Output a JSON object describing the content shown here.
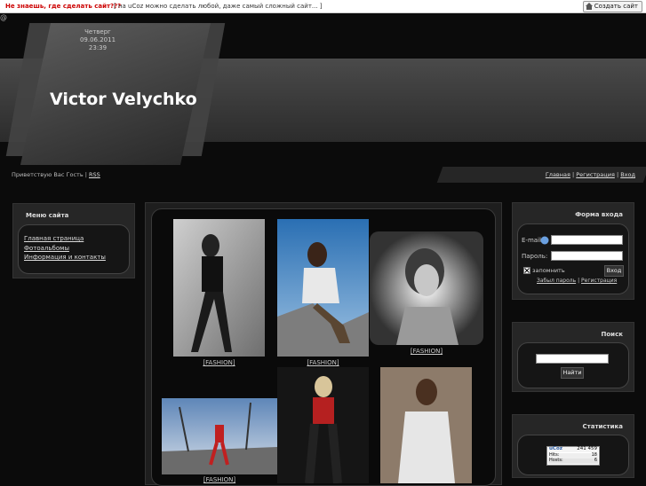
{
  "topbar": {
    "headline": "Не знаешь, где сделать сайт???",
    "message": "[ на uCoz можно сделать любой, даже самый сложный сайт... ]",
    "create_button": "Создать сайт"
  },
  "header": {
    "at_sign": "@",
    "day": "Четверг",
    "date": "09.06.2011",
    "time": "23:39",
    "site_title": "Victor Velychko"
  },
  "nav": {
    "greeting": "Приветствую Вас Гость |",
    "rss": "RSS",
    "links": [
      "Главная",
      "Регистрация",
      "Вход"
    ],
    "sep": "|"
  },
  "menu": {
    "title": "Меню сайта",
    "items": [
      "Главная страница",
      "Фотоальбомы",
      "Информация и контакты"
    ]
  },
  "gallery": {
    "captions": [
      "[FASHION]",
      "[FASHION]",
      "[FASHION]",
      "[FASHION]"
    ]
  },
  "login": {
    "title": "Форма входа",
    "email_label": "E-mail:",
    "password_label": "Пароль:",
    "remember_label": "запомнить",
    "submit": "Вход",
    "forgot": "Забыл пароль",
    "sep": "|",
    "register": "Регистрация"
  },
  "search": {
    "title": "Поиск",
    "button": "Найти"
  },
  "stats": {
    "title": "Статистика",
    "counter_brand": "uCoz",
    "counter_total": "241 459",
    "hits_label": "Hits:",
    "hits_value": "18",
    "hosts_label": "Hosts:",
    "hosts_value": "6"
  },
  "colors": {
    "accent_red": "#cc0000",
    "background": "#0b0b0b",
    "panel": "#262626"
  }
}
